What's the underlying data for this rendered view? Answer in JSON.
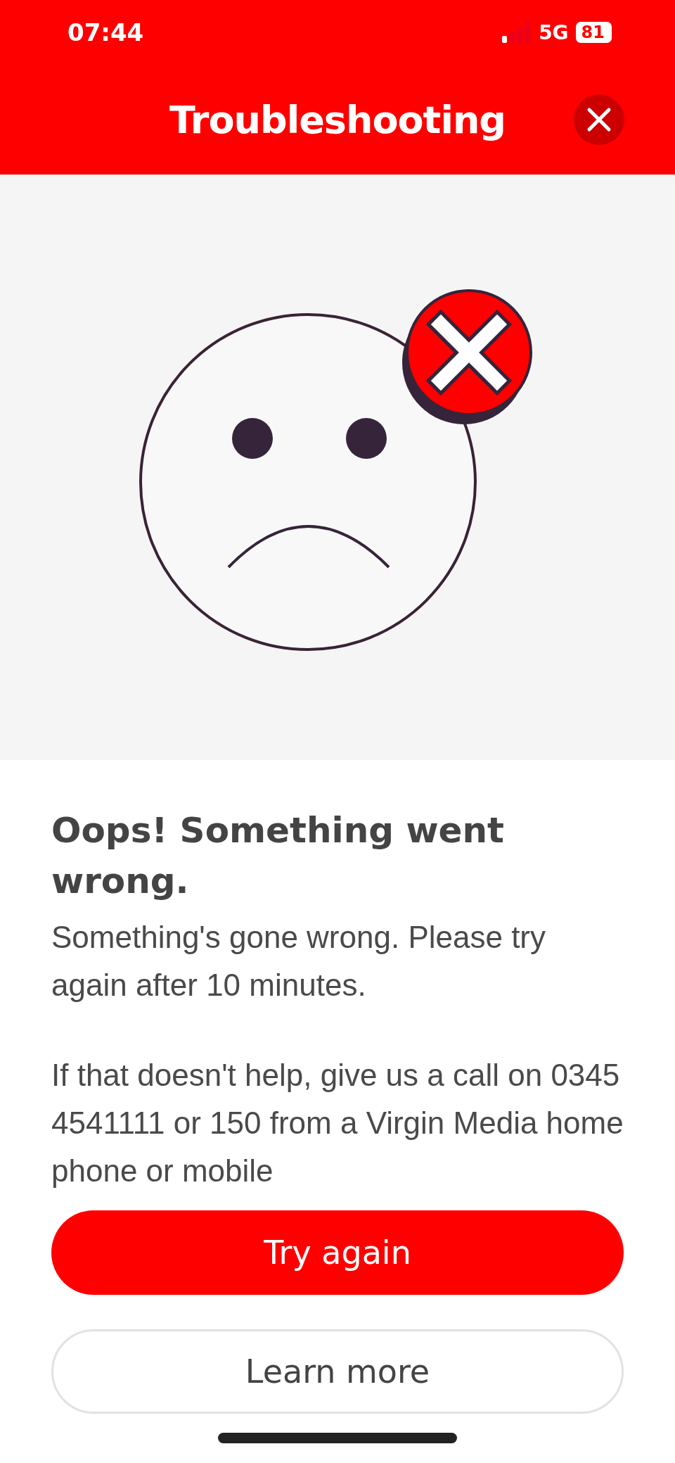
{
  "status_bar": {
    "time": "07:44",
    "network": "5G",
    "battery": "81"
  },
  "header": {
    "title": "Troubleshooting"
  },
  "message": {
    "title": "Oops! Something went wrong.",
    "paragraphs": [
      "Something's gone wrong. Please try again after 10 minutes.",
      "If that doesn't help, give us a call on 0345 4541111 or 150 from a Virgin Media home phone or mobile"
    ]
  },
  "buttons": [
    {
      "label": "Try again",
      "kind": "primary"
    },
    {
      "label": "Learn more",
      "kind": "secondary"
    }
  ]
}
